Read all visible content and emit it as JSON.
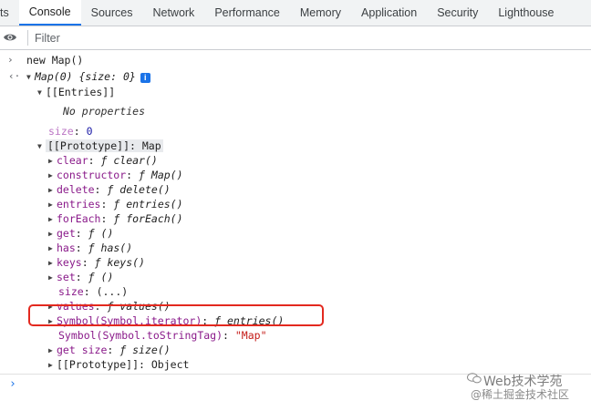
{
  "tabs": [
    {
      "label": "ts",
      "active": false
    },
    {
      "label": "Console",
      "active": true
    },
    {
      "label": "Sources",
      "active": false
    },
    {
      "label": "Network",
      "active": false
    },
    {
      "label": "Performance",
      "active": false
    },
    {
      "label": "Memory",
      "active": false
    },
    {
      "label": "Application",
      "active": false
    },
    {
      "label": "Security",
      "active": false
    },
    {
      "label": "Lighthouse",
      "active": false
    }
  ],
  "toolbar": {
    "filter_placeholder": "Filter",
    "eye_icon": "eye-icon"
  },
  "console": {
    "input": "new Map()",
    "result_head": "Map(0)",
    "result_size_brace": "{size: 0}",
    "info_badge": "i",
    "entries_label": "[[Entries]]",
    "no_properties": "No properties",
    "size_key": "size",
    "size_val": "0",
    "prototype_label": "[[Prototype]]",
    "prototype_val": "Map",
    "members": [
      {
        "key": "clear",
        "val": "clear()"
      },
      {
        "key": "constructor",
        "val": "Map()"
      },
      {
        "key": "delete",
        "val": "delete()"
      },
      {
        "key": "entries",
        "val": "entries()"
      },
      {
        "key": "forEach",
        "val": "forEach()"
      },
      {
        "key": "get",
        "val": "()"
      },
      {
        "key": "has",
        "val": "has()"
      },
      {
        "key": "keys",
        "val": "keys()"
      },
      {
        "key": "set",
        "val": "()"
      }
    ],
    "size_getter_key": "size",
    "size_getter_val": "(...)",
    "values_key": "values",
    "values_val": "values()",
    "iterator_key": "Symbol(Symbol.iterator)",
    "iterator_val": "entries()",
    "tostringtag_key": "Symbol(Symbol.toStringTag)",
    "tostringtag_val": "\"Map\"",
    "getsize_key": "get size",
    "getsize_val": "size()",
    "proto2_label": "[[Prototype]]",
    "proto2_val": "Object",
    "func_glyph": "ƒ"
  },
  "watermark": {
    "line1": "Web技术学苑",
    "line2": "@稀土掘金技术社区"
  },
  "colors": {
    "accent": "#1a73e8",
    "highlight_box": "#e3291f"
  }
}
